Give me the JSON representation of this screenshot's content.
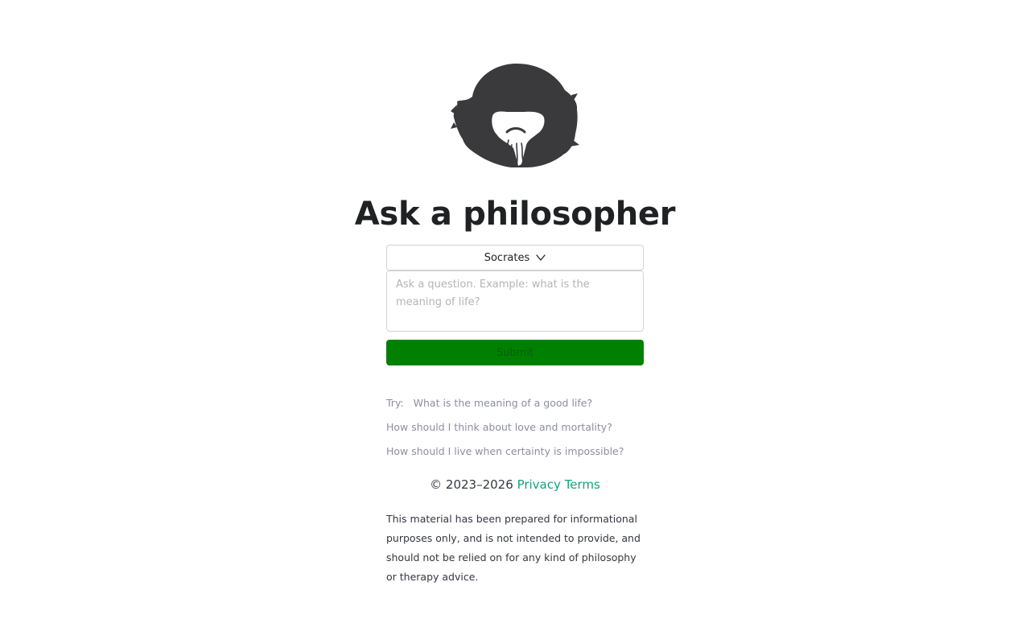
{
  "app": {
    "title": "Ask a philosopher"
  },
  "logo": {
    "icon": "philosopher-silhouette-icon",
    "color": "#3a393b"
  },
  "form": {
    "philosopher_selected": "Socrates",
    "question_placeholder": "Ask a question. Example: what is the meaning of life?",
    "question_value": "",
    "submit_label": "Submit",
    "submit_color": "#008000"
  },
  "examples": {
    "label": "Try:",
    "items": [
      "What is the meaning of a good life?",
      "How should I think about love and mortality?",
      "How should I live when certainty is impossible?"
    ]
  },
  "footer": {
    "copyright": "© 2023–2026",
    "privacy_label": "Privacy",
    "terms_label": "Terms",
    "link_color": "#10a37f"
  },
  "disclaimer": "This material has been prepared for informational purposes only, and is not intended to provide, and should not be relied on for any kind of philosophy or therapy advice."
}
